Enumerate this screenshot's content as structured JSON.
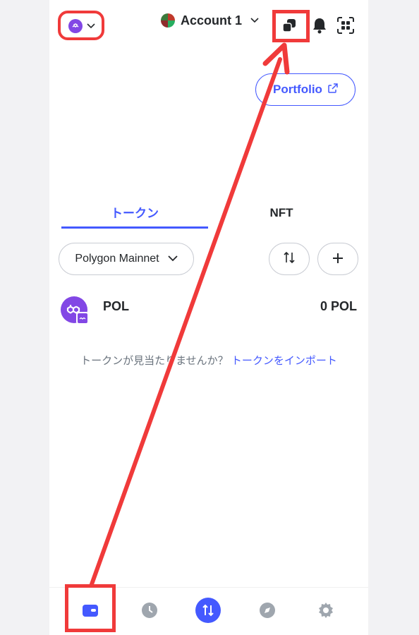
{
  "header": {
    "account_name": "Account 1"
  },
  "portfolio_label": "Portfolio",
  "tabs": [
    {
      "label": "トークン",
      "active": true
    },
    {
      "label": "NFT",
      "active": false
    }
  ],
  "filter": {
    "network_label": "Polygon Mainnet"
  },
  "tokens": [
    {
      "name": "POL",
      "balance": "0 POL"
    }
  ],
  "import_prompt": {
    "text": "トークンが見当たりませんか？",
    "link": "トークンをインポート"
  },
  "bottom_nav": [
    "wallet-icon",
    "history-icon",
    "swap-icon",
    "explore-icon",
    "settings-icon"
  ],
  "colors": {
    "accent": "#4459ff",
    "polygon": "#8247e5",
    "annotation": "#f03a3a"
  }
}
